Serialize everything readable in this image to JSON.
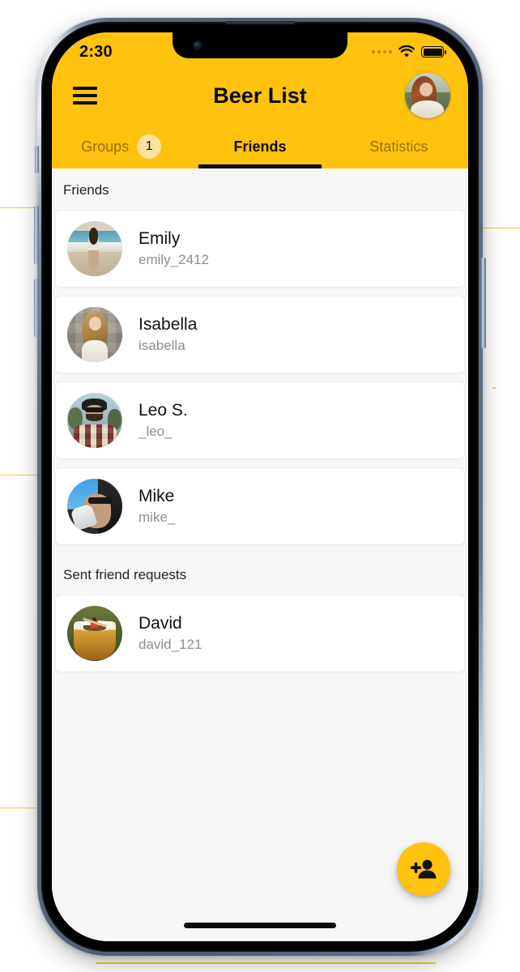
{
  "status_bar": {
    "time": "2:30",
    "cellular_icon": "cellular-dots-icon",
    "wifi_icon": "wifi-icon",
    "battery_icon": "battery-full-icon"
  },
  "header": {
    "menu_icon": "hamburger-menu-icon",
    "title": "Beer List",
    "avatar_alt": "user-profile-avatar"
  },
  "tabs": [
    {
      "label": "Groups",
      "badge": "1",
      "active": false
    },
    {
      "label": "Friends",
      "badge": null,
      "active": true
    },
    {
      "label": "Statistics",
      "badge": null,
      "active": false
    }
  ],
  "sections": [
    {
      "title": "Friends",
      "items": [
        {
          "name": "Emily",
          "handle": "emily_2412",
          "avatar": "av-emily"
        },
        {
          "name": "Isabella",
          "handle": "isabella",
          "avatar": "av-isabella"
        },
        {
          "name": "Leo S.",
          "handle": "_leo_",
          "avatar": "av-leo"
        },
        {
          "name": "Mike",
          "handle": "mike_",
          "avatar": "av-mike"
        }
      ]
    },
    {
      "title": "Sent friend requests",
      "items": [
        {
          "name": "David",
          "handle": "david_121",
          "avatar": "av-david"
        }
      ]
    }
  ],
  "fab": {
    "icon": "person-add-icon",
    "label": "Add friend"
  },
  "colors": {
    "brand_yellow": "#FFC20E",
    "badge_yellow": "#FBE2A0",
    "screen_background": "#F7F7F7",
    "card_background": "#FFFFFF",
    "primary_text": "#111111",
    "secondary_text": "#8E8E8E",
    "inactive_tab_text": "rgba(0,0,0,0.42)"
  }
}
